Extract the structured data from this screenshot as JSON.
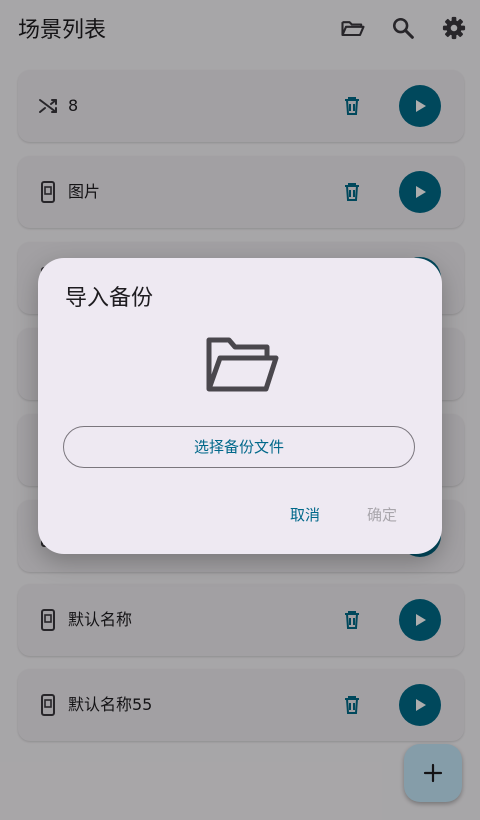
{
  "appbar": {
    "title": "场景列表",
    "icons": [
      "folder-open-icon",
      "search-icon",
      "gear-icon"
    ]
  },
  "scenes": [
    {
      "name": "8",
      "icon": "shuffle-icon"
    },
    {
      "name": "图片",
      "icon": "phone-icon"
    },
    {
      "name": "",
      "icon": "phone-icon"
    },
    {
      "name": "",
      "icon": "phone-icon"
    },
    {
      "name": "",
      "icon": "phone-icon"
    },
    {
      "name": "",
      "icon": "phone-icon"
    },
    {
      "name": "默认名称",
      "icon": "phone-icon"
    },
    {
      "name": "默认名称55",
      "icon": "phone-icon"
    }
  ],
  "dialog": {
    "title": "导入备份",
    "pick_button": "选择备份文件",
    "cancel": "取消",
    "confirm": "确定"
  },
  "fab": {
    "icon": "plus-icon"
  },
  "colors": {
    "accent": "#006a88",
    "background": "#f7f5f8",
    "card": "#efecf1",
    "dialog": "#eee9f2",
    "fab": "#c4e7f9",
    "disabled_text": "#a9a6ac"
  }
}
